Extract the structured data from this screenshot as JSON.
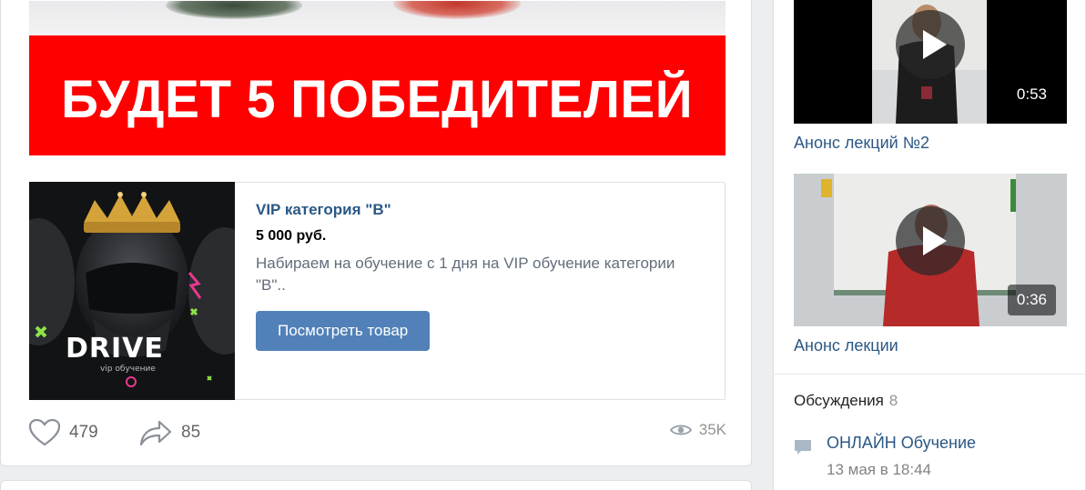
{
  "banner": {
    "text": "БУДЕТ 5 ПОБЕДИТЕЛЕЙ",
    "background_color": "#ff0000"
  },
  "product": {
    "title": "VIP категория \"B\"",
    "price": "5 000 руб.",
    "description": "Набираем на обучение с 1 дня на VIP обучение категории \"В\"..",
    "button_label": "Посмотреть товар",
    "image_logo": "DRIVE",
    "image_subtitle": "vip обучение"
  },
  "actions": {
    "likes": "479",
    "shares": "85",
    "views": "35K"
  },
  "videos": [
    {
      "duration": "0:53",
      "caption": "Анонс лекций №2"
    },
    {
      "duration": "0:36",
      "caption": "Анонс лекции"
    }
  ],
  "discussions": {
    "title": "Обсуждения",
    "count": "8",
    "items": [
      {
        "title": "ОНЛАЙН Обучение",
        "date": "13 мая в 18:44"
      }
    ]
  },
  "colors": {
    "link": "#2a5885",
    "button": "#5181b8",
    "page_bg": "#edeef0"
  }
}
